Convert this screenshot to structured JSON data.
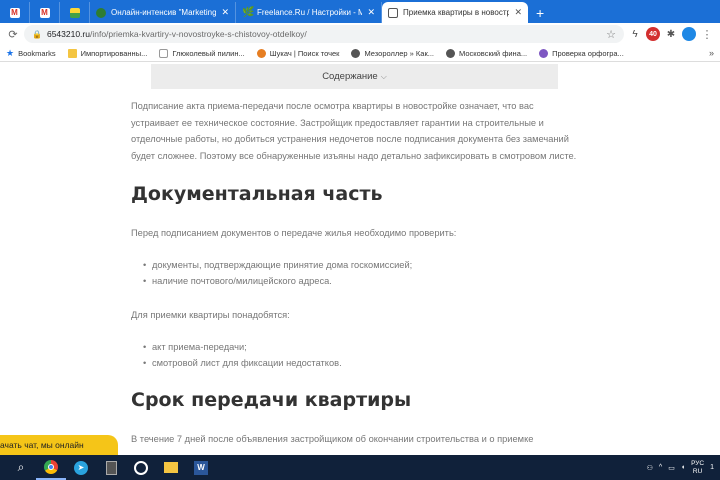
{
  "browser": {
    "tabs": [
      {
        "title": "",
        "icon": "gmail-icon",
        "color": "#d93025",
        "pinned": true
      },
      {
        "title": "",
        "icon": "gmail-icon",
        "color": "#d93025",
        "pinned": true
      },
      {
        "title": "",
        "icon": "image-icon",
        "color": "#4caf50",
        "pinned": true
      },
      {
        "title": "Онлайн-интенсив \"Marketing w",
        "icon": "site-icon",
        "color": "#2e7d32"
      },
      {
        "title": "Freelance.Ru / Настройки - Мой",
        "icon": "freelance-icon",
        "color": "#8bc34a"
      },
      {
        "title": "Приемка квартиры в новострой",
        "icon": "house-icon",
        "color": "#1565c0",
        "active": true
      }
    ],
    "new_tab_label": "+",
    "address": {
      "host": "6543210.ru",
      "path": "/info/priemka-kvartiry-v-novostroyke-s-chistovoy-otdelkoy/"
    },
    "extension_badge": "40",
    "bookmarks": [
      {
        "label": "Bookmarks",
        "icon": "star-icon"
      },
      {
        "label": "Импортированны...",
        "icon": "folder-icon"
      },
      {
        "label": "Глюколевый пилин...",
        "icon": "page-icon"
      },
      {
        "label": "Шукач | Поиск точек",
        "icon": "shukach-icon"
      },
      {
        "label": "Мезороллер » Как...",
        "icon": "globe-icon"
      },
      {
        "label": "Московский фина...",
        "icon": "globe-icon"
      },
      {
        "label": "Проверка орфогра...",
        "icon": "spell-icon"
      }
    ],
    "bookmarks_more": "»"
  },
  "page": {
    "toc_label": "Содержание",
    "intro": "Подписание акта приема-передачи после осмотра квартиры в новостройке означает, что вас устраивает ее техническое состояние. Застройщик предоставляет гарантии на строительные и отделочные работы, но добиться устранения недочетов после подписания документа без замечаний будет сложнее. Поэтому все обнаруженные изъяны надо детально зафиксировать в смотровом листе.",
    "heading1": "Документальная часть",
    "p1": "Перед подписанием документов о передаче жилья необходимо проверить:",
    "list1": [
      "документы, подтверждающие принятие дома госкомиссией;",
      "наличие почтового/милицейского адреса."
    ],
    "p2": "Для приемки квартиры понадобятся:",
    "list2": [
      "акт приема-передачи;",
      "смотровой лист для фиксации недостатков."
    ],
    "heading2": "Срок передачи квартиры",
    "p3": "В течение 7 дней после объявления застройщиком об окончании строительства и о приемке"
  },
  "chat_label": "ачать чат, мы онлайн",
  "taskbar": {
    "apps": [
      "start",
      "search",
      "chrome",
      "telegram",
      "calculator",
      "viber",
      "explorer",
      "word"
    ],
    "lang_top": "РУС",
    "lang_bottom": "RU",
    "clock": "1"
  },
  "colors": {
    "tabstrip": "#1b6fd6",
    "taskbar": "#10213a",
    "chat": "#f5c518",
    "heading": "#333333",
    "body_text": "#777777"
  }
}
